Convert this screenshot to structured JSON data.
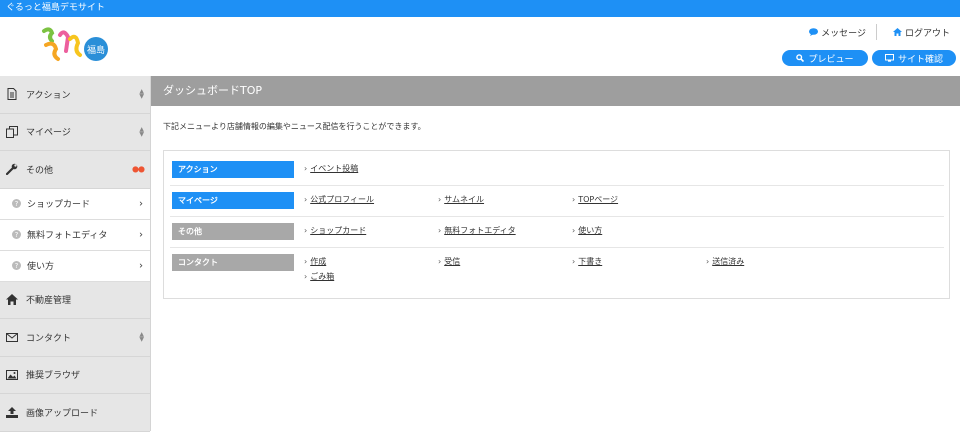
{
  "site": {
    "title": "ぐるっと福島デモサイト"
  },
  "header": {
    "logo_alt": "ぐるっと福島",
    "logo_badge": "福島",
    "message_label": "メッセージ",
    "logout_label": "ログアウト",
    "preview_label": "プレビュー",
    "site_check_label": "サイト確認"
  },
  "sidebar": {
    "items": [
      {
        "label": "アクション",
        "icon": "document-icon"
      },
      {
        "label": "マイページ",
        "icon": "copy-icon"
      },
      {
        "label": "その他",
        "icon": "wrench-icon"
      }
    ],
    "sub_items": [
      {
        "label": "ショップカード"
      },
      {
        "label": "無料フォトエディタ"
      },
      {
        "label": "使い方"
      }
    ],
    "bottom_items": [
      {
        "label": "不動産管理",
        "icon": "home-icon"
      },
      {
        "label": "コンタクト",
        "icon": "envelope-icon"
      },
      {
        "label": "推奨ブラウザ",
        "icon": "image-icon"
      },
      {
        "label": "画像アップロード",
        "icon": "upload-icon"
      }
    ]
  },
  "main": {
    "title": "ダッシュボードTOP",
    "description": "下記メニューより店舗情報の編集やニュース配信を行うことができます。",
    "rows": [
      {
        "label": "アクション",
        "links": [
          "イベント投稿"
        ]
      },
      {
        "label": "マイページ",
        "links": [
          "公式プロフィール",
          "サムネイル",
          "TOPページ"
        ]
      },
      {
        "label": "その他",
        "links": [
          "ショップカード",
          "無料フォトエディタ",
          "使い方"
        ]
      },
      {
        "label": "コンタクト",
        "links": [
          "作成",
          "受信",
          "下書き",
          "送信済み",
          "ごみ箱"
        ]
      }
    ]
  },
  "colors": {
    "accent": "#1e90f5",
    "title_bar": "#9e9e9e",
    "sidebar_bg": "#e6e6e6",
    "label_gray": "#a8a8a8"
  }
}
